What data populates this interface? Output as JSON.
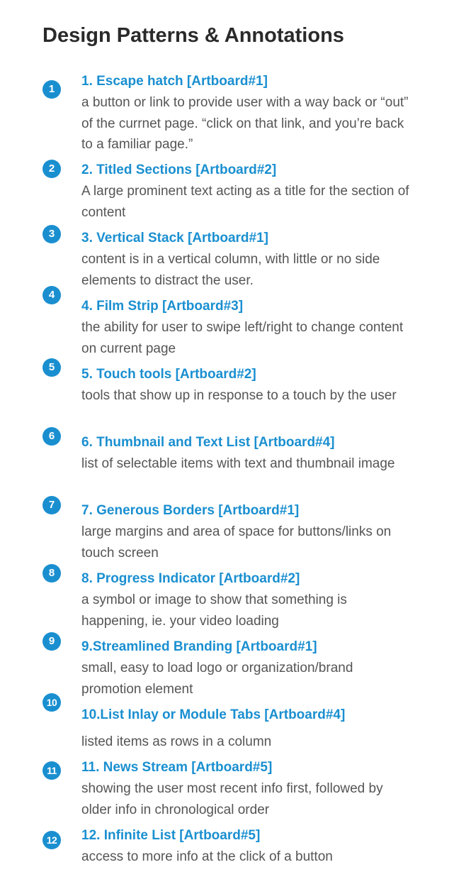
{
  "title": "Design Patterns & Annotations",
  "items": [
    {
      "number": "1",
      "title": "1. Escape hatch [Artboard#1]",
      "desc": "a button  or link to provide user with a way back or “out” of the currnet page. “click on that link, and you’re back to a familiar page.”"
    },
    {
      "number": "2",
      "title": "2. Titled Sections [Artboard#2]",
      "desc": "A large prominent text acting as a title for the section of content"
    },
    {
      "number": "3",
      "title": "3. Vertical Stack [Artboard#1]",
      "desc": "content is in a vertical column, with little or no side elements to distract the user."
    },
    {
      "number": "4",
      "title": "4. Film Strip [Artboard#3]",
      "desc": "the ability for user to swipe left/right to change content on current page"
    },
    {
      "number": "5",
      "title": "5. Touch tools [Artboard#2]",
      "desc": "tools that show up in response to a touch by the user"
    },
    {
      "number": "6",
      "title": "6. Thumbnail and Text List [Artboard#4]",
      "desc": "list of selectable items with text and thumbnail image"
    },
    {
      "number": "7",
      "title": "7. Generous Borders [Artboard#1]",
      "desc": "large margins and area of space for buttons/links on touch screen"
    },
    {
      "number": "8",
      "title": "8. Progress Indicator [Artboard#2]",
      "desc": "a symbol or image to show that something is happening, ie. your video loading"
    },
    {
      "number": "9",
      "title": "9.Streamlined Branding [Artboard#1]",
      "desc": "small, easy to load logo or organization/brand promotion element"
    },
    {
      "number": "10",
      "title": "10.List Inlay or Module Tabs [Artboard#4]",
      "desc": "listed items as rows in a column"
    },
    {
      "number": "11",
      "title": "11. News Stream [Artboard#5]",
      "desc": "showing the user most recent info first, followed by older info in chronological order"
    },
    {
      "number": "12",
      "title": "12. Infinite List [Artboard#5]",
      "desc": "access to more info at the click of a button"
    }
  ]
}
